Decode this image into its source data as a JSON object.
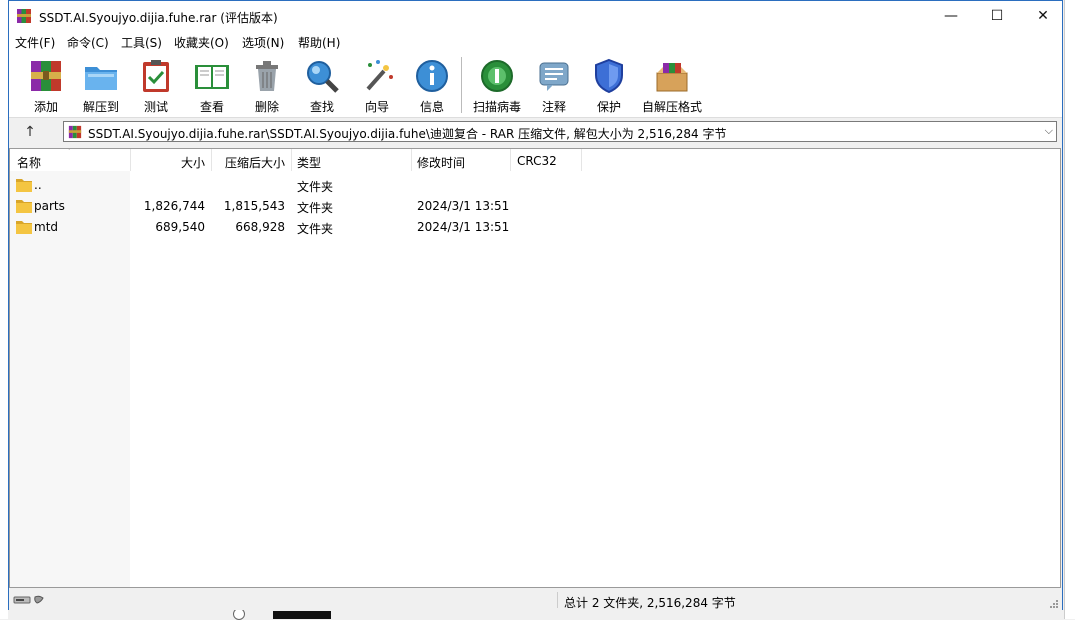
{
  "window": {
    "title": "SSDT.AI.Syoujyo.dijia.fuhe.rar (评估版本)",
    "controls": {
      "minimize": "—",
      "maximize": "☐",
      "close": "✕"
    }
  },
  "menu": [
    "文件(F)",
    "命令(C)",
    "工具(S)",
    "收藏夹(O)",
    "选项(N)",
    "帮助(H)"
  ],
  "toolbar": {
    "buttons": [
      {
        "label": "添加",
        "icon": "add-archive-icon"
      },
      {
        "label": "解压到",
        "icon": "extract-folder-icon"
      },
      {
        "label": "测试",
        "icon": "test-clipboard-icon"
      },
      {
        "label": "查看",
        "icon": "view-book-icon"
      },
      {
        "label": "删除",
        "icon": "trash-icon"
      },
      {
        "label": "查找",
        "icon": "magnifier-icon"
      },
      {
        "label": "向导",
        "icon": "wizard-wand-icon"
      },
      {
        "label": "信息",
        "icon": "info-icon"
      },
      {
        "label": "扫描病毒",
        "icon": "virus-scan-icon"
      },
      {
        "label": "注释",
        "icon": "comment-icon"
      },
      {
        "label": "保护",
        "icon": "shield-icon"
      },
      {
        "label": "自解压格式",
        "icon": "sfx-box-icon"
      }
    ]
  },
  "address": {
    "up": "↑",
    "path": "SSDT.AI.Syoujyo.dijia.fuhe.rar\\SSDT.AI.Syoujyo.dijia.fuhe\\迪迦复合 - RAR 压缩文件, 解包大小为 2,516,284 字节",
    "dropdown": "⌵"
  },
  "columns": {
    "name": "名称",
    "size": "大小",
    "packed": "压缩后大小",
    "type": "类型",
    "modified": "修改时间",
    "crc": "CRC32",
    "sort_caret": "ˇ"
  },
  "files": [
    {
      "name": "..",
      "size": "",
      "packed": "",
      "type": "文件夹",
      "modified": "",
      "crc": ""
    },
    {
      "name": "parts",
      "size": "1,826,744",
      "packed": "1,815,543",
      "type": "文件夹",
      "modified": "2024/3/1 13:51",
      "crc": ""
    },
    {
      "name": "mtd",
      "size": "689,540",
      "packed": "668,928",
      "type": "文件夹",
      "modified": "2024/3/1 13:51",
      "crc": ""
    }
  ],
  "status": {
    "summary": "总计 2 文件夹, 2,516,284 字节"
  },
  "colors": {
    "window_border": "#2b6ebf",
    "folder": "#f4c542",
    "folder_dark": "#d9a62a"
  }
}
